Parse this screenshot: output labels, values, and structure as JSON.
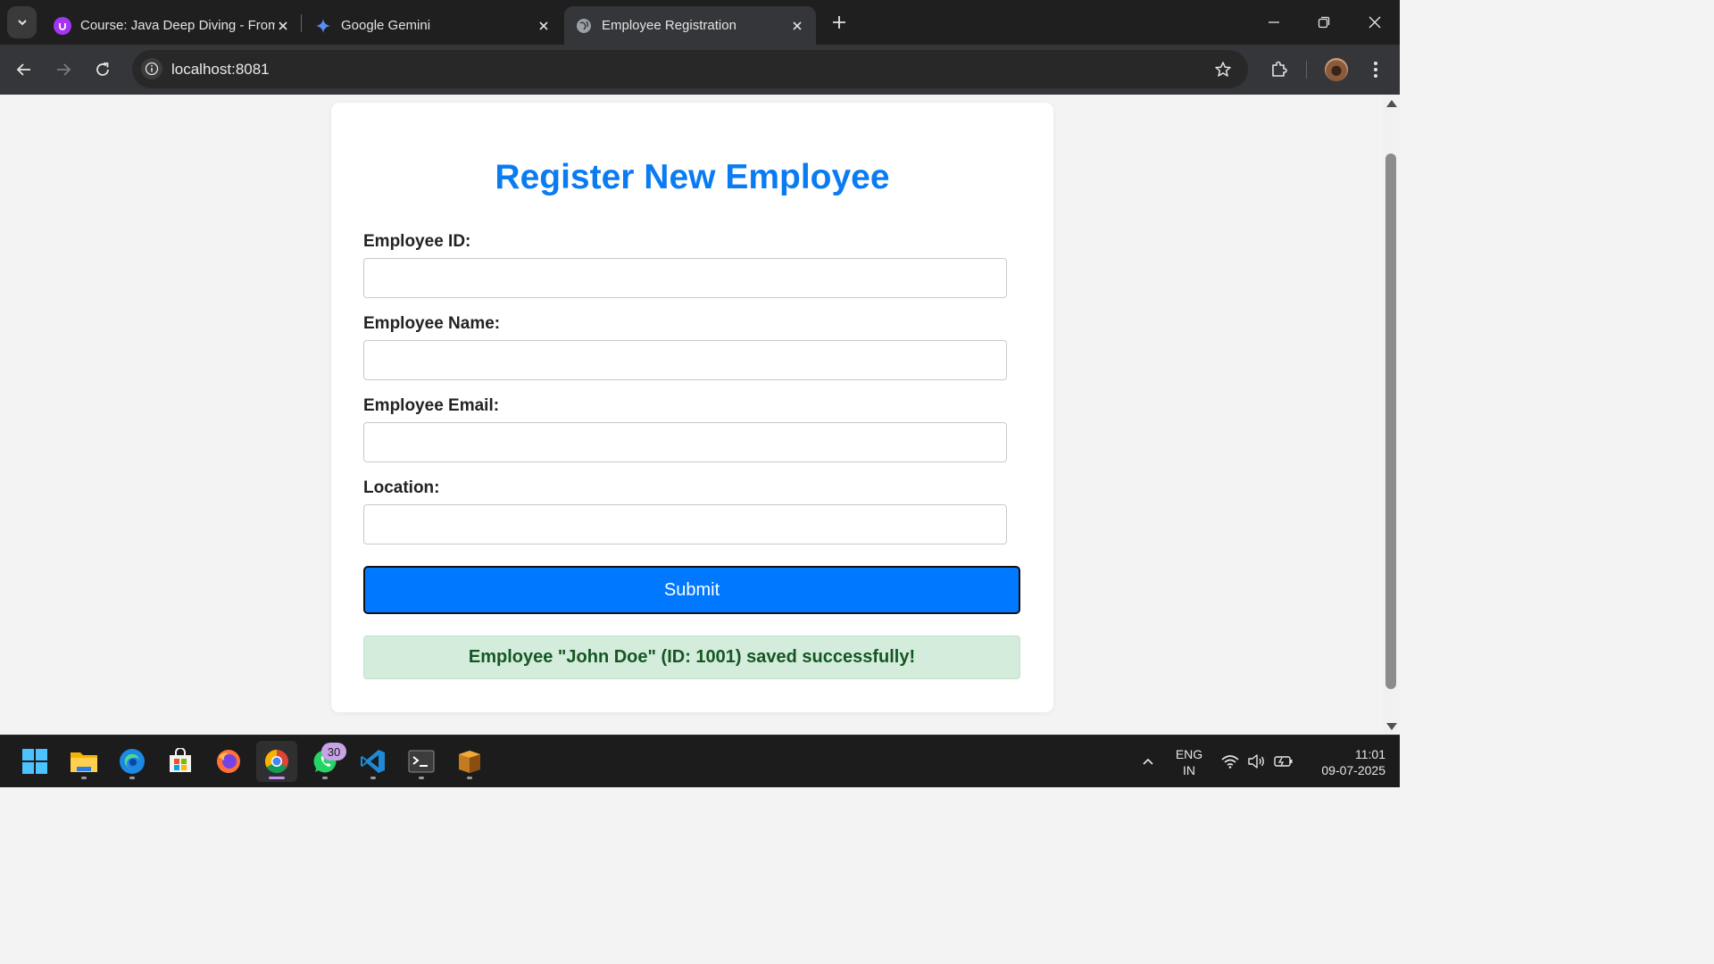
{
  "browser": {
    "tabs": [
      {
        "title": "Course: Java Deep Diving - From",
        "icon": "udemy-icon"
      },
      {
        "title": "Google Gemini",
        "icon": "gemini-icon"
      },
      {
        "title": "Employee Registration",
        "icon": "globe-icon",
        "active": true
      }
    ],
    "url": "localhost:8081"
  },
  "page": {
    "heading": "Register New Employee",
    "fields": [
      {
        "label": "Employee ID:",
        "value": "",
        "type": "text"
      },
      {
        "label": "Employee Name:",
        "value": "",
        "type": "text"
      },
      {
        "label": "Employee Email:",
        "value": "",
        "type": "email"
      },
      {
        "label": "Location:",
        "value": "",
        "type": "text"
      }
    ],
    "submit_label": "Submit",
    "success_message": "Employee \"John Doe\" (ID: 1001) saved successfully!"
  },
  "taskbar": {
    "apps": [
      "windows-start",
      "file-explorer",
      "edge",
      "microsoft-store",
      "firefox",
      "chrome",
      "whatsapp",
      "vscode",
      "terminal",
      "winrar"
    ],
    "whatsapp_badge": "30",
    "language": "ENG",
    "region": "IN",
    "time": "11:01",
    "date": "09-07-2025"
  },
  "colors": {
    "heading": "#0a7cf2",
    "submit_bg": "#0078ff",
    "success_bg": "#d4ecdb",
    "success_text": "#155724"
  }
}
